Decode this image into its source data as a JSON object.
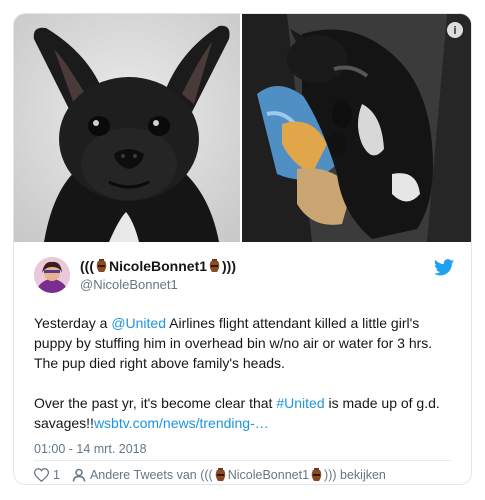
{
  "tweet": {
    "display_name_prefix": "(((",
    "display_name": "NicoleBonnet1",
    "display_name_suffix": ")))",
    "handle": "@NicoleBonnet1",
    "text_line1_pre": "Yesterday a ",
    "mention": "@United",
    "text_line1_post": " Airlines flight attendant killed a little girl's puppy by stuffing him in overhead bin w/no air or water for 3 hrs. The pup died right above family's heads.",
    "text_line2_pre": "Over the past yr, it's become clear that ",
    "hashtag": "#United",
    "text_line2_mid": " is made up of g.d. savages!!",
    "link": "wsbtv.com/news/trending-…",
    "timestamp": "01:00 - 14 mrt. 2018",
    "likes": "1",
    "more_tweets_label": "Andere Tweets van",
    "more_tweets_name_prefix": "(((",
    "more_tweets_name": "NicoleBonnet1",
    "more_tweets_name_suffix": ")))",
    "more_tweets_suffix": "bekijken"
  },
  "media": {
    "left_photo": "french-bulldog-portrait",
    "right_photo": "puppy-in-carrier-bag",
    "info_icon": "info-icon"
  },
  "colors": {
    "link": "#1b95e0",
    "secondary_text": "#657786",
    "twitter_blue": "#1da1f2",
    "border": "#e1e8ed"
  }
}
